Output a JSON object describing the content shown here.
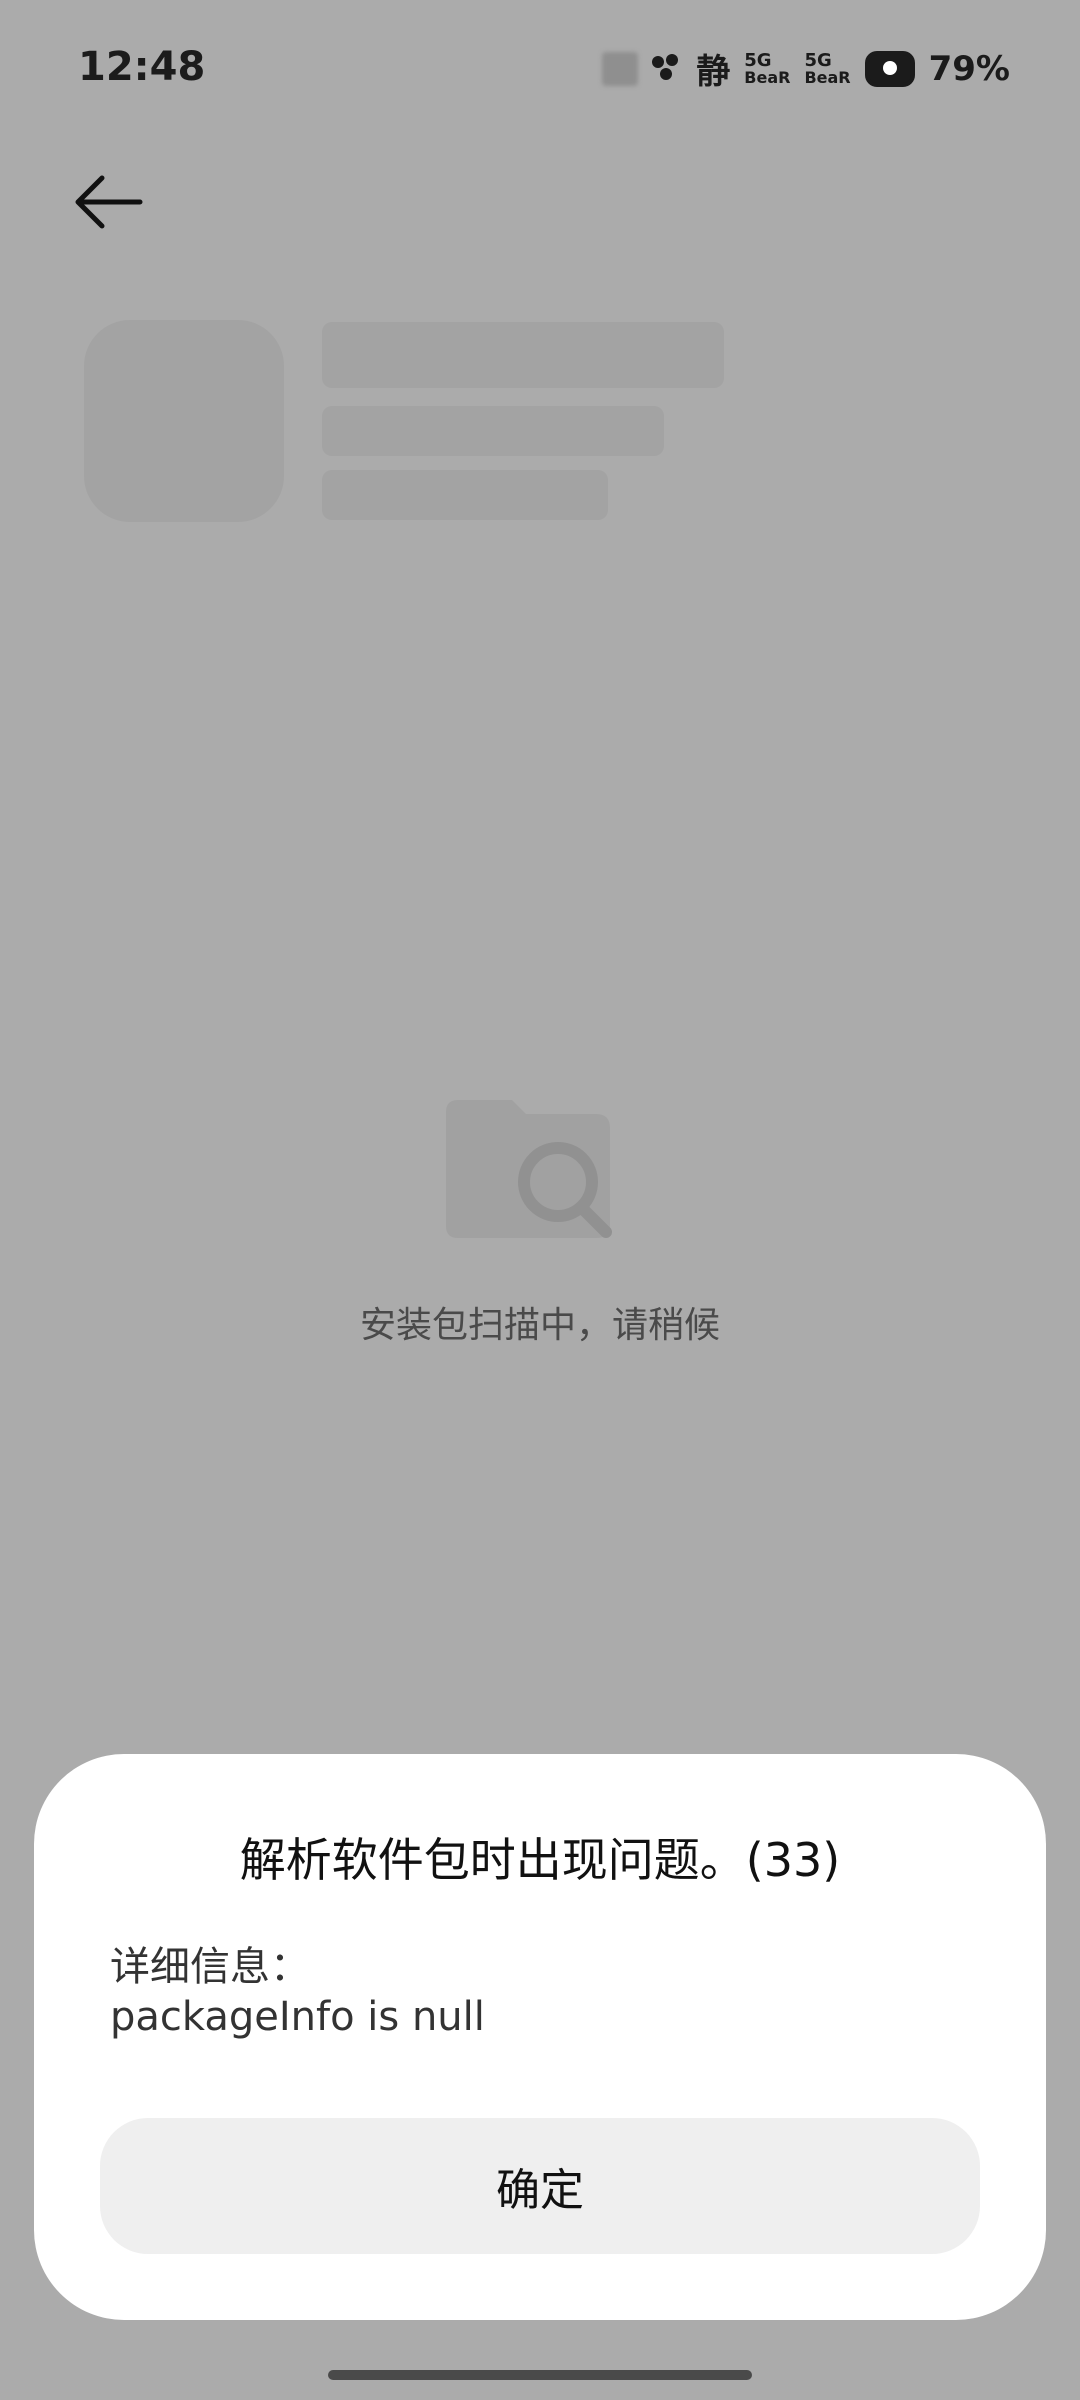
{
  "status_bar": {
    "time": "12:48",
    "silent_label": "静",
    "network": [
      {
        "gen": "5G",
        "brand": "BeaR"
      },
      {
        "gen": "5G",
        "brand": "BeaR"
      }
    ],
    "battery": "79%"
  },
  "header": {
    "back_icon": "arrow-left-icon"
  },
  "main": {
    "scan_icon": "folder-search-icon",
    "scanning_text": "安装包扫描中，请稍候"
  },
  "dialog": {
    "title": "解析软件包时出现问题。(33)",
    "detail_label": "详细信息：",
    "detail_value": "packageInfo is null",
    "confirm_label": "确定"
  },
  "colors": {
    "background": "#ababab",
    "dialog_bg": "#ffffff",
    "button_bg": "#efefef"
  }
}
